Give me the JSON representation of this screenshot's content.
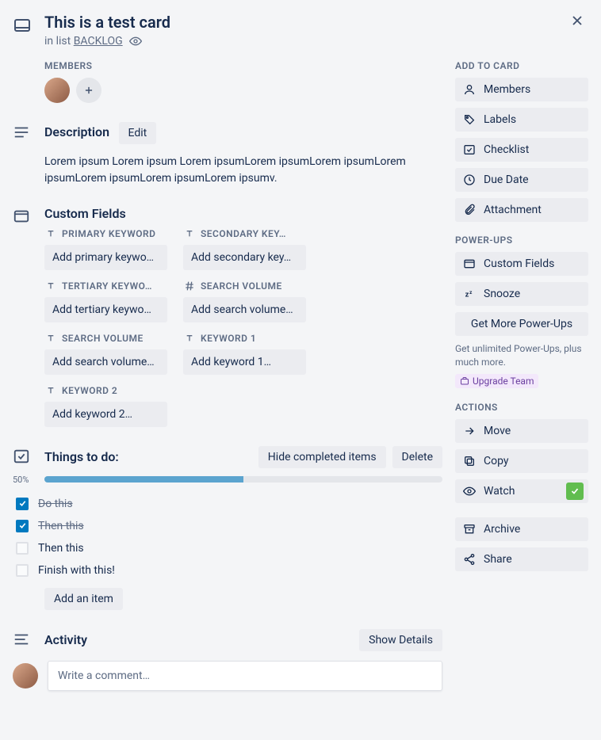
{
  "header": {
    "title": "This is a test card",
    "in_list_prefix": "in list ",
    "list_name": "BACKLOG"
  },
  "members": {
    "heading": "MEMBERS"
  },
  "description": {
    "heading": "Description",
    "edit_label": "Edit",
    "body": "Lorem ipsum Lorem ipsum Lorem ipsumLorem ipsumLorem ipsumLorem ipsumLorem ipsumLorem ipsumLorem ipsumv."
  },
  "custom_fields": {
    "heading": "Custom Fields",
    "fields": [
      {
        "icon": "text",
        "label": "PRIMARY KEYWORD",
        "placeholder": "Add primary keywo…"
      },
      {
        "icon": "text",
        "label": "SECONDARY KEY…",
        "placeholder": "Add secondary key…"
      },
      {
        "icon": "text",
        "label": "TERTIARY KEYWO…",
        "placeholder": "Add tertiary keywo…"
      },
      {
        "icon": "hash",
        "label": "SEARCH VOLUME",
        "placeholder": "Add search volume…"
      },
      {
        "icon": "text",
        "label": "SEARCH VOLUME",
        "placeholder": "Add search volume…"
      },
      {
        "icon": "text",
        "label": "KEYWORD 1",
        "placeholder": "Add keyword 1…"
      },
      {
        "icon": "text",
        "label": "KEYWORD 2",
        "placeholder": "Add keyword 2…"
      }
    ]
  },
  "checklist": {
    "heading": "Things to do:",
    "hide_label": "Hide completed items",
    "delete_label": "Delete",
    "progress_pct": "50%",
    "progress_value": 50,
    "items": [
      {
        "done": true,
        "text": "Do this"
      },
      {
        "done": true,
        "text": "Then this"
      },
      {
        "done": false,
        "text": "Then this"
      },
      {
        "done": false,
        "text": "Finish with this!"
      }
    ],
    "add_item_label": "Add an item"
  },
  "activity": {
    "heading": "Activity",
    "show_details_label": "Show Details",
    "comment_placeholder": "Write a comment…"
  },
  "sidebar": {
    "add_heading": "ADD TO CARD",
    "add": [
      {
        "icon": "user",
        "label": "Members"
      },
      {
        "icon": "tag",
        "label": "Labels"
      },
      {
        "icon": "check",
        "label": "Checklist"
      },
      {
        "icon": "clock",
        "label": "Due Date"
      },
      {
        "icon": "attach",
        "label": "Attachment"
      }
    ],
    "powerups_heading": "POWER-UPS",
    "powerups": [
      {
        "icon": "card",
        "label": "Custom Fields"
      },
      {
        "icon": "snooze",
        "label": "Snooze"
      }
    ],
    "get_more_label": "Get More Power-Ups",
    "powerup_note": "Get unlimited Power-Ups, plus much more.",
    "upgrade_label": "Upgrade Team",
    "actions_heading": "ACTIONS",
    "actions": [
      {
        "icon": "arrow",
        "label": "Move"
      },
      {
        "icon": "copy",
        "label": "Copy"
      },
      {
        "icon": "eye",
        "label": "Watch",
        "checked": true
      }
    ],
    "actions2": [
      {
        "icon": "archive",
        "label": "Archive"
      },
      {
        "icon": "share",
        "label": "Share"
      }
    ]
  }
}
